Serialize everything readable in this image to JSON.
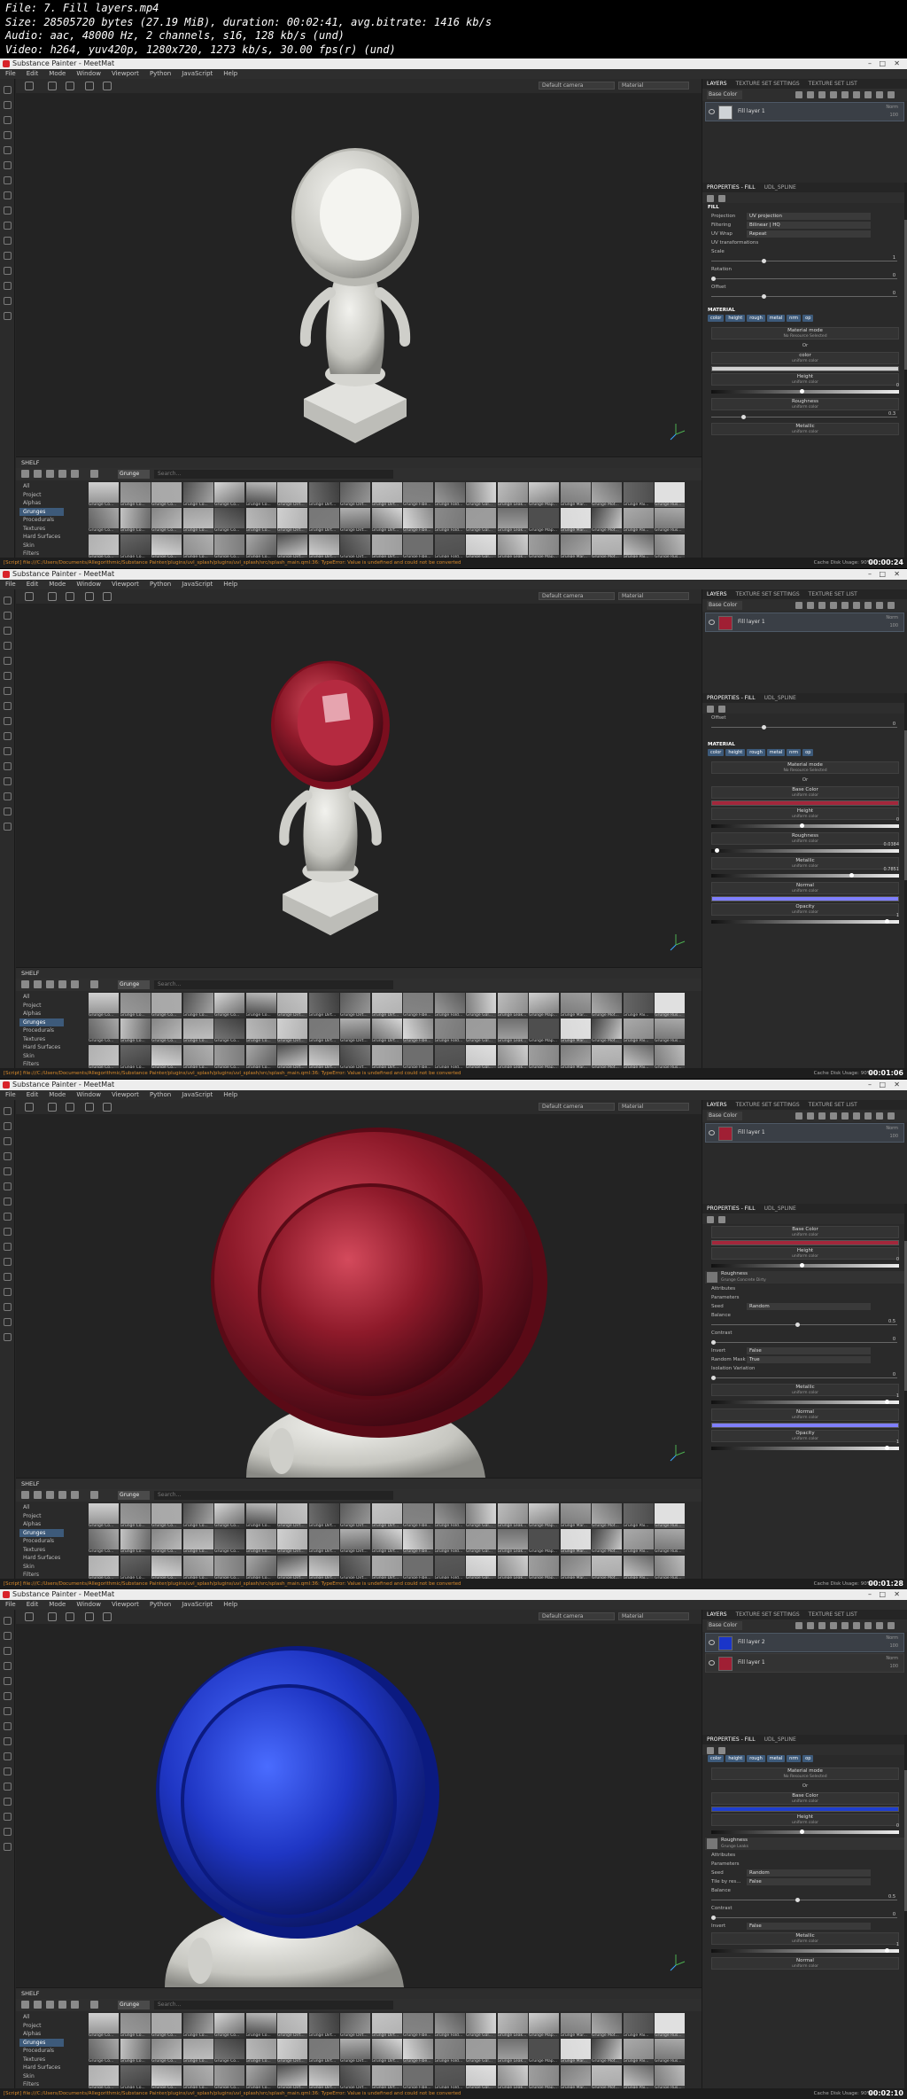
{
  "header": {
    "lines": [
      "File: 7. Fill layers.mp4",
      "Size: 28505720 bytes (27.19 MiB), duration: 00:02:41, avg.bitrate: 1416 kb/s",
      "Audio: aac, 48000 Hz, 2 channels, s16, 128 kb/s (und)",
      "Video: h264, yuv420p, 1280x720, 1273 kb/s, 30.00 fps(r) (und)"
    ]
  },
  "common": {
    "window_title": "Substance Painter - MeetMat",
    "menu": [
      "File",
      "Edit",
      "Mode",
      "Window",
      "Viewport",
      "Python",
      "JavaScript",
      "Help"
    ],
    "camera_select": "Default camera",
    "material_select": "Material",
    "layers_tabs": [
      "LAYERS",
      "TEXTURE SET SETTINGS",
      "TEXTURE SET LIST"
    ],
    "base_color_select": "Base Color",
    "shelf_title": "SHELF",
    "shelf_filter": "Grunge",
    "shelf_search_placeholder": "Search...",
    "shelf_categories": [
      "All",
      "Project",
      "Alphas",
      "Grunges",
      "Procedurals",
      "Textures",
      "Hard Surfaces",
      "Skin",
      "Filters",
      "Brushes",
      "Particles",
      "Tools",
      "Materials"
    ],
    "shelf_active_category": "Grunges",
    "thumb_labels": [
      "Grunge Co...",
      "Grunge Co...",
      "Grunge Co...",
      "Grunge Co...",
      "Grunge Co...",
      "Grunge Co...",
      "Grunge Dirt...",
      "Grunge Dirt...",
      "Grunge Dirt...",
      "Grunge Dirt...",
      "Grunge Fibe...",
      "Grunge Fold...",
      "Grunge Gal...",
      "Grunge Leak...",
      "Grunge Map...",
      "Grunge Mar...",
      "Grunge Mot...",
      "Grunge Pai...",
      "Grunge Rus..."
    ],
    "status_text": "[Script] file:///C:/Users/Documents/Allegorithmic/Substance Painter/plugins/uvl_splash/plugins/uvl_splash/src/splash_main.qml:36: TypeError: Value is undefined and could not be converted",
    "cache_text": "Cache Disk Usage: 90%",
    "props_tabs": [
      "PROPERTIES - FILL",
      "UDL_SPLINE"
    ],
    "layer_blend": "Norm",
    "layer_opacity": "100",
    "channels": [
      "color",
      "height",
      "rough",
      "metal",
      "nrm",
      "op"
    ],
    "material_mode_title": "Material mode",
    "material_mode_sub": "No Resource Selected",
    "or_text": "Or",
    "uniform_color": "uniform color"
  },
  "frames": [
    {
      "timestamp": "00:00:24",
      "layers": [
        {
          "name": "Fill layer 1",
          "color": "#cfd3d6"
        }
      ],
      "fill": {
        "title": "FILL",
        "projection_label": "Projection",
        "projection": "UV projection",
        "filtering_label": "Filtering",
        "filtering": "Bilinear | HQ",
        "uvwrap_label": "UV Wrap",
        "uvwrap": "Repeat",
        "uvtrans": "UV transformations",
        "scale_label": "Scale",
        "scale": "1",
        "rotation_label": "Rotation",
        "rotation": "0",
        "offset_label": "Offset",
        "offset_a": "0",
        "offset_b": "0"
      },
      "material_title": "MATERIAL",
      "base_color": "#d0d0d0",
      "height_label": "Height",
      "height_value": "0",
      "roughness_label": "Roughness",
      "roughness_value": "0.3",
      "metallic_label": "Metallic"
    },
    {
      "timestamp": "00:01:06",
      "layers": [
        {
          "name": "Fill layer 1",
          "color": "#a01f34"
        }
      ],
      "offset_label": "Offset",
      "offset_a": "0",
      "offset_b": "0",
      "material_title": "MATERIAL",
      "base_color": "#a3273b",
      "height_label": "Height",
      "height_value": "0",
      "roughness_label": "Roughness",
      "roughness_value": "0.0384",
      "metallic_label": "Metallic",
      "metallic_value": "0.7851",
      "normal_label": "Normal",
      "normal_color": "#7f7fff",
      "opacity_label": "Opacity",
      "opacity_value": "1"
    },
    {
      "timestamp": "00:01:28",
      "layers": [
        {
          "name": "Fill layer 1",
          "color": "#a01f34"
        }
      ],
      "base_color_title": "Base Color",
      "base_color": "#a3273b",
      "height_label": "Height",
      "height_value": "0",
      "roughness_label": "Roughness",
      "roughness_res": "Grunge Concrete Dirty",
      "attributes": "Attributes",
      "parameters": "Parameters",
      "seed_label": "Seed",
      "seed": "Random",
      "balance_label": "Balance",
      "balance": "0.5",
      "contrast_label": "Contrast",
      "contrast": "0",
      "invert_label": "Invert",
      "invert": "False",
      "random_mask_label": "Random Mask",
      "random_mask": "True",
      "iso_label": "Isolation Variation",
      "iso": "0",
      "metallic_label": "Metallic",
      "metallic_value": "1",
      "normal_label": "Normal",
      "normal_color": "#7f7fff",
      "opacity_label": "Opacity",
      "opacity_value": "1"
    },
    {
      "timestamp": "00:02:10",
      "layers": [
        {
          "name": "Fill layer 2",
          "color": "#1a35c9"
        },
        {
          "name": "Fill layer 1",
          "color": "#a01f34"
        }
      ],
      "material_title": "MATERIAL",
      "base_color": "#1f3fd0",
      "height_label": "Height",
      "height_value": "0",
      "roughness_label": "Roughness",
      "roughness_res": "Grunge Leaks",
      "attributes": "Attributes",
      "parameters": "Parameters",
      "seed_label": "Seed",
      "seed": "Random",
      "tile_label": "Tile by res...",
      "tile": "False",
      "balance_label": "Balance",
      "balance": "0.5",
      "contrast_label": "Contrast",
      "contrast": "0",
      "invert_label": "Invert",
      "invert": "False",
      "metallic_label": "Metallic",
      "metallic_value": "1",
      "normal_label": "Normal"
    }
  ]
}
